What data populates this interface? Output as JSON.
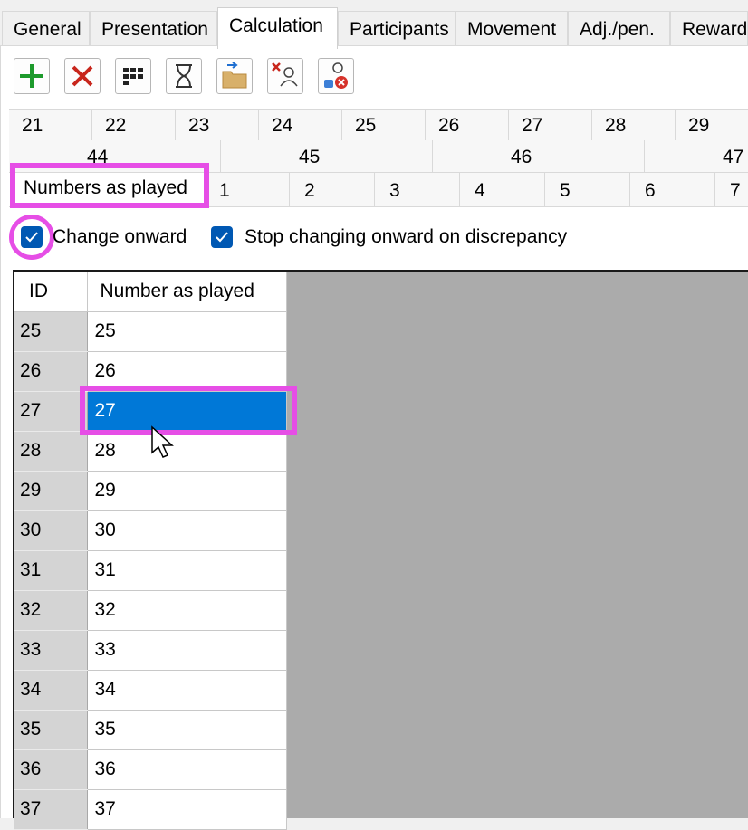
{
  "tabs": [
    {
      "label": "General",
      "active": false
    },
    {
      "label": "Presentation",
      "active": false
    },
    {
      "label": "Calculation",
      "active": true
    },
    {
      "label": "Participants",
      "active": false
    },
    {
      "label": "Movement",
      "active": false
    },
    {
      "label": "Adj./pen.",
      "active": false
    },
    {
      "label": "Reward",
      "active": false
    }
  ],
  "toolbar": {
    "add_icon": "plus-icon",
    "delete_icon": "x-icon",
    "grid_icon": "grid-icon",
    "hourglass_icon": "hourglass-icon",
    "import_icon": "folder-import-icon",
    "remove_participant_icon": "remove-user-icon",
    "remove_pairs_icon": "remove-pairs-icon"
  },
  "round_strip_top": [
    "21",
    "22",
    "23",
    "24",
    "25",
    "26",
    "27",
    "28",
    "29"
  ],
  "round_strip_mid": [
    "44",
    "45",
    "46",
    "47"
  ],
  "round_strip_bottom": {
    "label": "Numbers as played",
    "items": [
      "1",
      "2",
      "3",
      "4",
      "5",
      "6",
      "7"
    ]
  },
  "options": {
    "change_onward": {
      "label": "Change onward",
      "checked": true
    },
    "stop_on_discrepancy": {
      "label": "Stop changing onward on discrepancy",
      "checked": true
    }
  },
  "grid": {
    "columns": [
      "ID",
      "Number as played"
    ],
    "rows": [
      [
        "25",
        "25"
      ],
      [
        "26",
        "26"
      ],
      [
        "27",
        "27"
      ],
      [
        "28",
        "28"
      ],
      [
        "29",
        "29"
      ],
      [
        "30",
        "30"
      ],
      [
        "31",
        "31"
      ],
      [
        "32",
        "32"
      ],
      [
        "33",
        "33"
      ],
      [
        "34",
        "34"
      ],
      [
        "35",
        "35"
      ],
      [
        "36",
        "36"
      ],
      [
        "37",
        "37"
      ]
    ],
    "selected_row": "27"
  },
  "colors": {
    "highlight": "#e64ee6",
    "selection": "#0078d7",
    "checkbox": "#0058b3"
  }
}
